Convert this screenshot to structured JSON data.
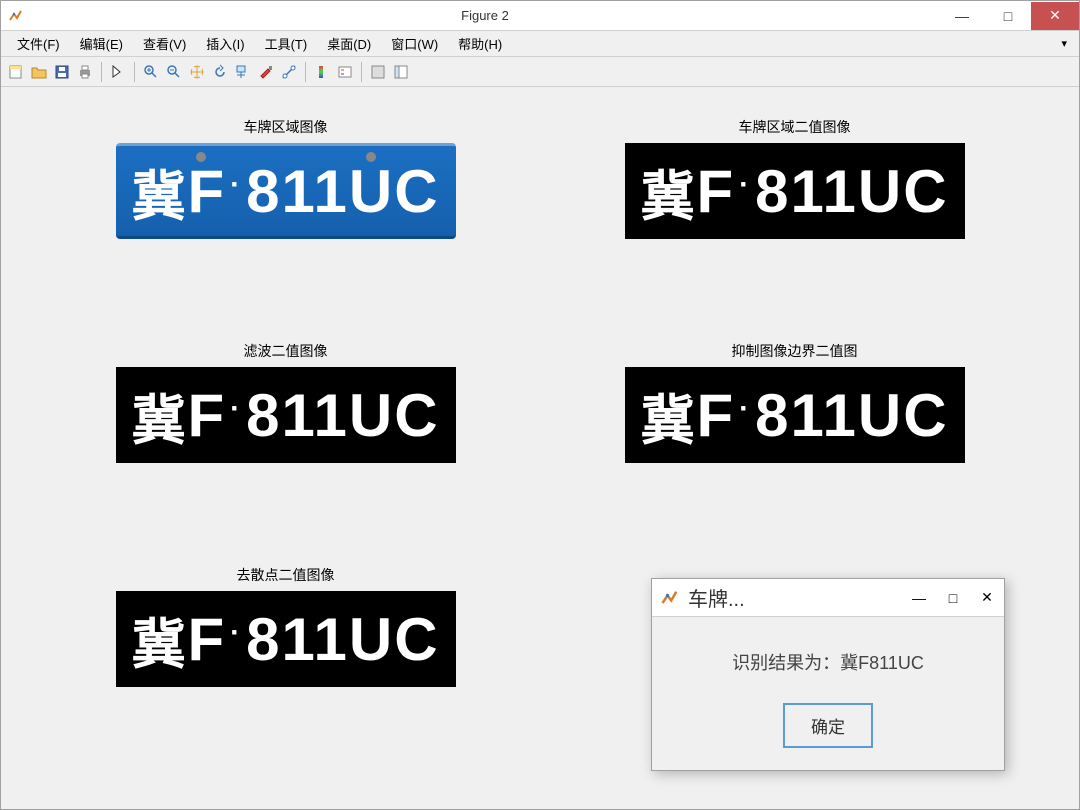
{
  "window": {
    "title": "Figure 2"
  },
  "menu": {
    "file": "文件(F)",
    "edit": "编辑(E)",
    "view": "查看(V)",
    "insert": "插入(I)",
    "tools": "工具(T)",
    "desktop": "桌面(D)",
    "window": "窗口(W)",
    "help": "帮助(H)"
  },
  "subplots": {
    "t1": "车牌区域图像",
    "t2": "车牌区域二值图像",
    "t3": "滤波二值图像",
    "t4": "抑制图像边界二值图",
    "t5": "去散点二值图像"
  },
  "plate_text": {
    "province": "冀",
    "letters": "F",
    "dot": "·",
    "digits": "811",
    "suffix": "UC"
  },
  "dialog": {
    "title": "车牌...",
    "result_label": "识别结果为：",
    "result_value": "冀F811UC",
    "ok": "确定"
  }
}
